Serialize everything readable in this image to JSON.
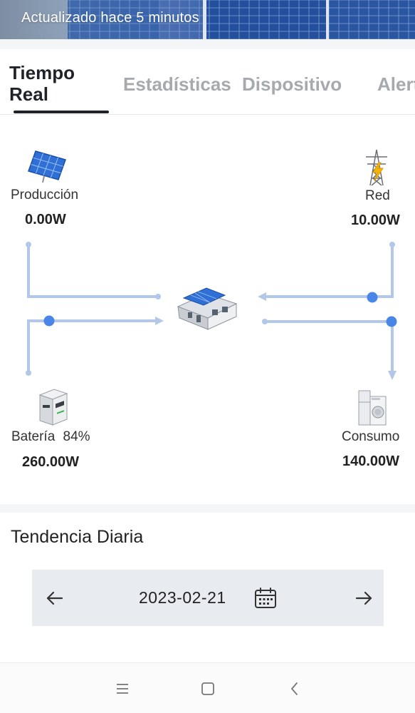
{
  "header": {
    "updated_text": "Actualizado hace 5 minutos"
  },
  "tabs": [
    {
      "label_line1": "Tiempo",
      "label_line2": "Real",
      "active": true
    },
    {
      "label": "Estadísticas"
    },
    {
      "label": "Dispositivo"
    },
    {
      "label": "Alert"
    }
  ],
  "flow": {
    "production": {
      "label": "Producción",
      "value": "0.00W",
      "icon": "solar-panel-icon"
    },
    "grid": {
      "label": "Red",
      "value": "10.00W",
      "icon": "power-tower-icon"
    },
    "battery": {
      "label": "Batería",
      "percent": "84%",
      "value": "260.00W",
      "icon": "battery-cabinet-icon"
    },
    "consumption": {
      "label": "Consumo",
      "value": "140.00W",
      "icon": "appliances-icon"
    },
    "house_icon": "house-icon",
    "line_color": "#b3c7e8",
    "dot_color": "#4a86e8"
  },
  "trend": {
    "title": "Tendencia Diaria",
    "date": "2023-02-21",
    "prev_icon": "arrow-left-icon",
    "next_icon": "arrow-right-icon",
    "calendar_icon": "calendar-icon"
  },
  "system_nav": {
    "menu_icon": "menu-icon",
    "home_icon": "home-square-icon",
    "back_icon": "back-chevron-icon"
  }
}
